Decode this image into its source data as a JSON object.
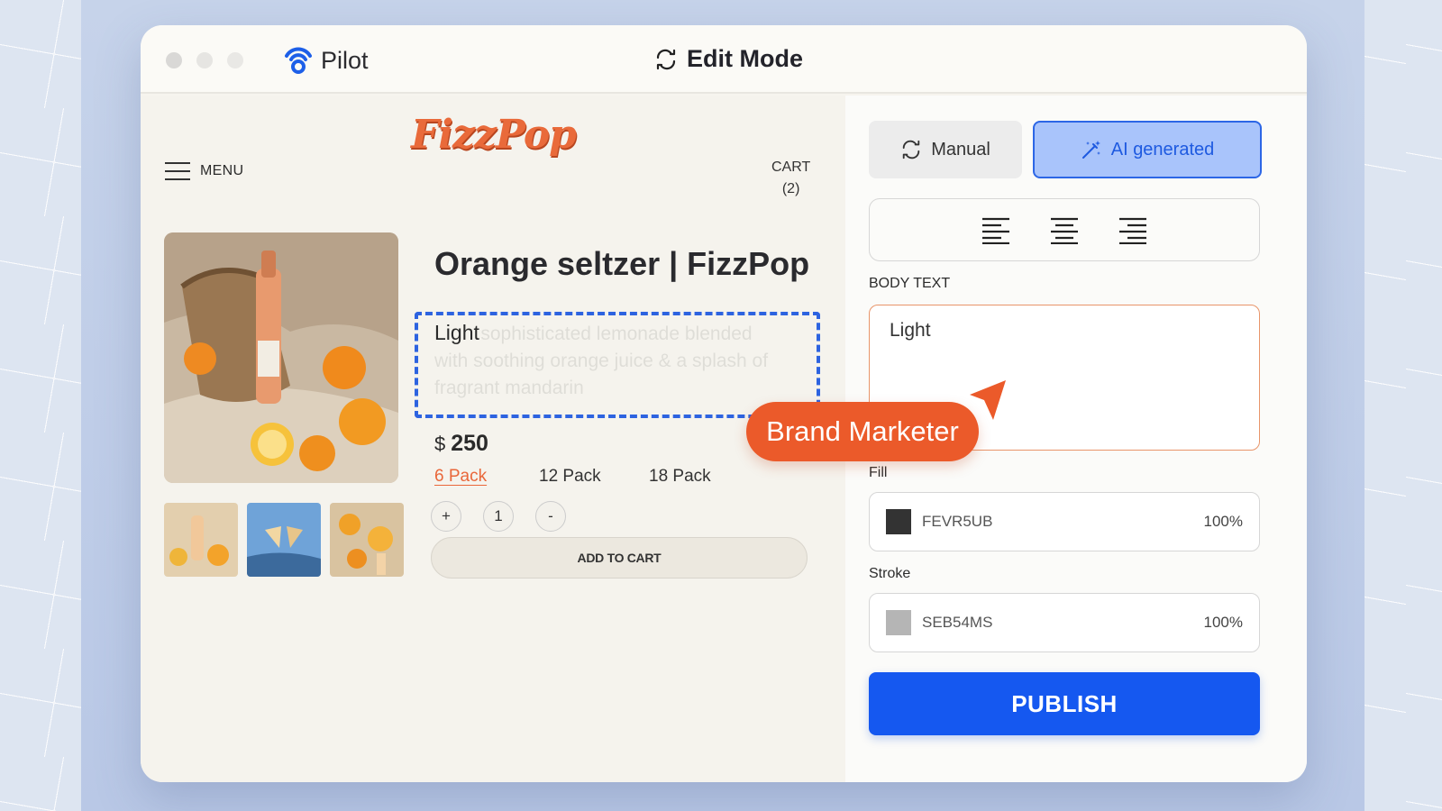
{
  "app": {
    "name": "Pilot",
    "mode_label": "Edit Mode"
  },
  "store": {
    "logo": "FizzPop",
    "menu_label": "MENU",
    "cart_label": "CART",
    "cart_count": "(2)"
  },
  "product": {
    "title": "Orange seltzer | FizzPop",
    "body_visible": "Light",
    "body_ghost_1": "Light sophisticated lemonade blended",
    "body_ghost_2": "with soothing orange juice & a splash of",
    "body_ghost_3": "fragrant mandarin",
    "currency": "$",
    "price": "250",
    "packs": [
      "6 Pack",
      "12 Pack",
      "18 Pack"
    ],
    "selected_pack": "6 Pack",
    "qty_plus": "+",
    "quantity": "1",
    "qty_minus": "-",
    "add_to_cart": "ADD TO CART"
  },
  "collaborator": {
    "tag": "Brand Marketer",
    "color": "#eb5a2a"
  },
  "editor": {
    "tab_manual": "Manual",
    "tab_ai": "AI generated",
    "active_tab": "AI generated",
    "body_text_label": "BODY TEXT",
    "body_text_value": "Light",
    "fill_label": "Fill",
    "fill_hex": "FEVR5UB",
    "fill_opacity": "100%",
    "fill_color": "#333333",
    "stroke_label": "Stroke",
    "stroke_hex": "SEB54MS",
    "stroke_opacity": "100%",
    "stroke_color": "#b5b5b5",
    "publish": "PUBLISH"
  },
  "colors": {
    "accent": "#1558f0",
    "brand": "#e96a3a",
    "selection": "#2d63e0"
  }
}
